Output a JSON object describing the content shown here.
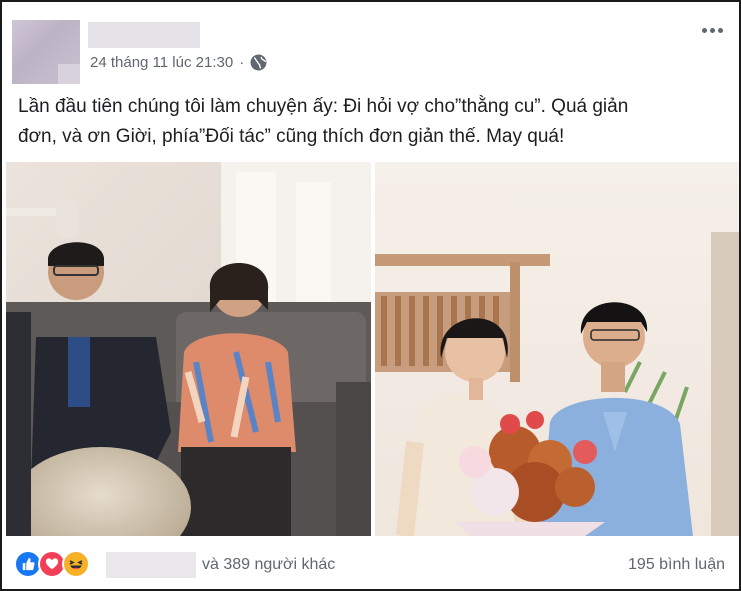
{
  "post": {
    "timestamp": "24 tháng 11 lúc 21:30",
    "separator": "·",
    "privacy_icon": "globe-icon",
    "more_icon": "more-horizontal-icon",
    "text_line1": "Lần đầu tiên chúng tôi làm chuyện ấy: Đi hỏi vợ cho”thằng cu”. Quá giản",
    "text_line2": "đơn, và ơn Giời, phía”Đối tác” cũng thích đơn giản thế. May quá!"
  },
  "photos": [
    {
      "subject": "people seated on sofa in living room"
    },
    {
      "subject": "couple holding flower bouquet"
    }
  ],
  "footer": {
    "reaction_icons": [
      "like-icon",
      "love-icon",
      "haha-icon"
    ],
    "reactor_text": "và 389 người khác",
    "comments_text": "195 bình luận"
  },
  "colors": {
    "like": "#1877f2",
    "love": "#f33e58",
    "haha": "#f7b125",
    "meta_text": "#606770"
  }
}
